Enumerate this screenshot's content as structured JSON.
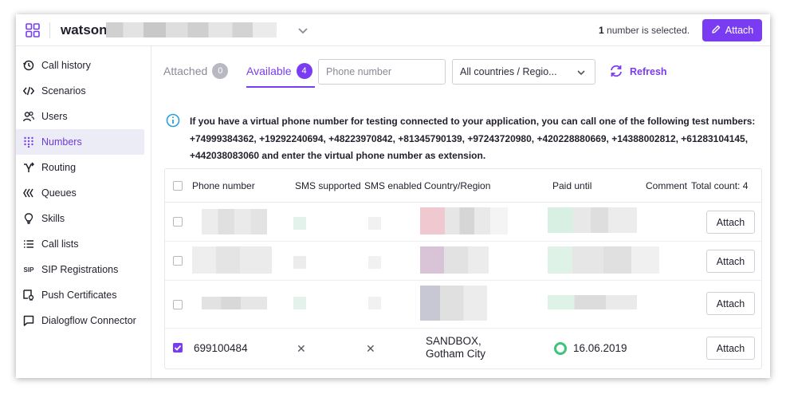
{
  "topbar": {
    "app_name": "watson.",
    "selection_count": "1",
    "selection_suffix": " number is selected.",
    "attach_label": "Attach"
  },
  "sidebar": {
    "items": [
      {
        "label": "Call history",
        "icon": "history-icon",
        "active": false
      },
      {
        "label": "Scenarios",
        "icon": "code-icon",
        "active": false
      },
      {
        "label": "Users",
        "icon": "users-icon",
        "active": false
      },
      {
        "label": "Numbers",
        "icon": "dialpad-icon",
        "active": true
      },
      {
        "label": "Routing",
        "icon": "routing-icon",
        "active": false
      },
      {
        "label": "Queues",
        "icon": "queues-icon",
        "active": false
      },
      {
        "label": "Skills",
        "icon": "bulb-icon",
        "active": false
      },
      {
        "label": "Call lists",
        "icon": "list-icon",
        "active": false
      },
      {
        "label": "SIP Registrations",
        "icon": "sip-icon",
        "active": false
      },
      {
        "label": "Push Certificates",
        "icon": "certificate-icon",
        "active": false
      },
      {
        "label": "Dialogflow Connector",
        "icon": "dialogflow-icon",
        "active": false
      }
    ]
  },
  "tabs": {
    "attached": {
      "label": "Attached",
      "count": "0"
    },
    "available": {
      "label": "Available",
      "count": "4"
    }
  },
  "filters": {
    "phone_placeholder": "Phone number",
    "country_value": "All countries / Regio...",
    "refresh_label": "Refresh"
  },
  "info": {
    "text": "If you have a virtual phone number for testing connected to your application, you can call one of the following test numbers: +74999384362, +19292240694, +48223970842, +81345790139, +97243720980, +420228880669, +14388002812, +61283104145, +442038083060 and enter the virtual phone number as extension."
  },
  "table": {
    "headers": {
      "phone": "Phone number",
      "sms_supported": "SMS supported",
      "sms_enabled": "SMS enabled",
      "country": "Country/Region",
      "paid_until": "Paid until",
      "comment": "Comment",
      "total": "Total count: 4"
    },
    "rows": [
      {
        "phone": "",
        "sms_supported": "",
        "sms_enabled": "",
        "country_line1": "",
        "country_line2": "",
        "paid_until": "",
        "checked": false,
        "attach_label": "Attach"
      },
      {
        "phone": "",
        "sms_supported": "",
        "sms_enabled": "",
        "country_line1": "",
        "country_line2": "",
        "paid_until": "",
        "checked": false,
        "attach_label": "Attach"
      },
      {
        "phone": "",
        "sms_supported": "",
        "sms_enabled": "",
        "country_line1": "",
        "country_line2": "",
        "paid_until": "",
        "checked": false,
        "attach_label": "Attach"
      },
      {
        "phone": "699100484",
        "sms_supported": "✕",
        "sms_enabled": "✕",
        "country_line1": "SANDBOX,",
        "country_line2": "Gotham City",
        "paid_until": "16.06.2019",
        "checked": true,
        "attach_label": "Attach"
      }
    ]
  },
  "colors": {
    "accent": "#7a3cf0",
    "status_active": "#3ec47a",
    "info_icon": "#2aa0d8"
  }
}
